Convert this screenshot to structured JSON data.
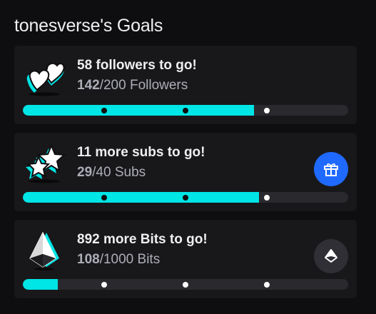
{
  "panel": {
    "title": "tonesverse's Goals"
  },
  "colors": {
    "progress_fill": "#00e5e5",
    "progress_track": "#2a2a2e",
    "subs_button": "#1f69ff",
    "bits_button": "#2f2f35",
    "card_background": "#18181b"
  },
  "goals": [
    {
      "icon": "hearts-icon",
      "heading": "58 followers to go!",
      "current": "142",
      "target_text": "/200 Followers",
      "progress": 0.71,
      "milestones": [
        0.25,
        0.5,
        0.75
      ]
    },
    {
      "icon": "stars-icon",
      "heading": "11 more subs to go!",
      "current": "29",
      "target_text": "/40 Subs",
      "progress": 0.725,
      "milestones": [
        0.25,
        0.5,
        0.75
      ],
      "action_icon": "gift-icon"
    },
    {
      "icon": "bits-gem-icon",
      "heading": "892 more Bits to go!",
      "current": "108",
      "target_text": "/1000 Bits",
      "progress": 0.108,
      "milestones": [
        0.25,
        0.5,
        0.75
      ],
      "action_icon": "bits-icon"
    }
  ]
}
